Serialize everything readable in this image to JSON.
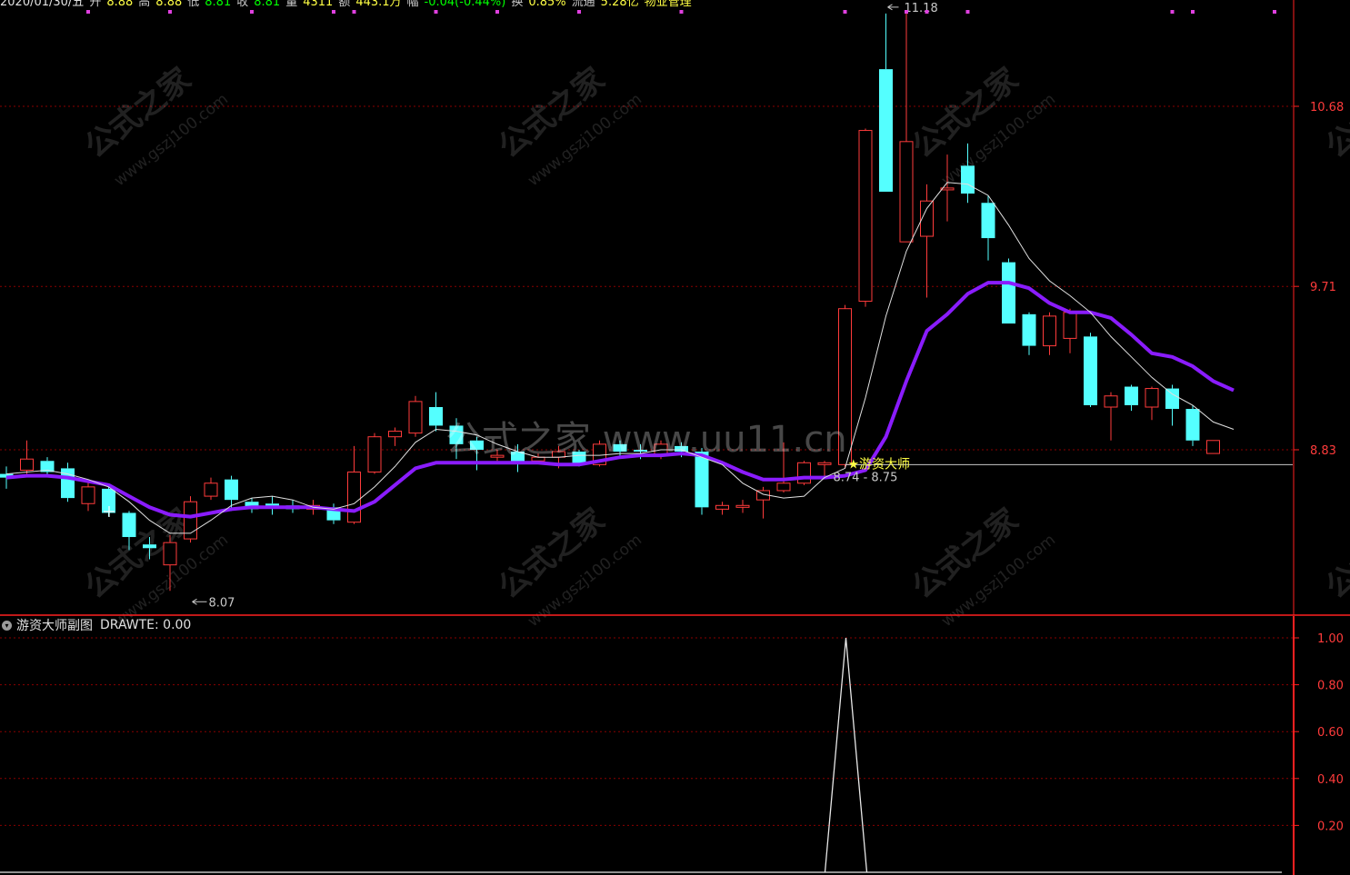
{
  "top_status": {
    "date": "2020/01/30/五",
    "open_label": "开",
    "open": "8.88",
    "high_label": "高",
    "high": "8.88",
    "low_label": "低",
    "low": "8.81",
    "close_label": "收",
    "close": "8.81",
    "volume_label": "量",
    "volume": "4311",
    "amount_label": "额",
    "amount": "443.1万",
    "change_label": "幅",
    "change": "-0.04(-0.44%)",
    "turnover_label": "换",
    "turnover": "0.85%",
    "float_label": "流通",
    "float": "5.28亿",
    "sector": "物业管理"
  },
  "watermark": {
    "brand": "公式之家",
    "site": "www.gszj100.com",
    "center": "公式之家 www.uu11.cn"
  },
  "annotations": {
    "high_label": "11.18",
    "low_label": "8.07",
    "signal_label": "★游资大师",
    "range_label": "8.74 - 8.75"
  },
  "sub_panel": {
    "title": "游资大师副图",
    "indicator": "DRAWTE: 0.00"
  },
  "colors": {
    "up": "#ff3b3b",
    "down": "#54ffff",
    "ma_long": "#8a1cff",
    "ma_short": "#e0e0e0",
    "axis": "#ff2020",
    "grid": "#8a0000",
    "signal": "#ffff44"
  },
  "chart_data": [
    {
      "type": "candlestick",
      "title": "",
      "y_ticks": [
        "10.68",
        "9.71",
        "8.83"
      ],
      "ylim": [
        7.95,
        11.5
      ],
      "grid": true,
      "candles": [
        {
          "o": 8.7,
          "c": 8.68,
          "h": 8.74,
          "l": 8.62
        },
        {
          "o": 8.72,
          "c": 8.78,
          "h": 8.88,
          "l": 8.7
        },
        {
          "o": 8.77,
          "c": 8.71,
          "h": 8.79,
          "l": 8.69
        },
        {
          "o": 8.73,
          "c": 8.57,
          "h": 8.76,
          "l": 8.55
        },
        {
          "o": 8.54,
          "c": 8.63,
          "h": 8.66,
          "l": 8.5
        },
        {
          "o": 8.62,
          "c": 8.49,
          "h": 8.64,
          "l": 8.47
        },
        {
          "o": 8.49,
          "c": 8.36,
          "h": 8.5,
          "l": 8.29
        },
        {
          "o": 8.32,
          "c": 8.3,
          "h": 8.36,
          "l": 8.24
        },
        {
          "o": 8.21,
          "c": 8.33,
          "h": 8.37,
          "l": 8.07
        },
        {
          "o": 8.35,
          "c": 8.55,
          "h": 8.58,
          "l": 8.33
        },
        {
          "o": 8.58,
          "c": 8.65,
          "h": 8.68,
          "l": 8.56
        },
        {
          "o": 8.67,
          "c": 8.56,
          "h": 8.69,
          "l": 8.5
        },
        {
          "o": 8.55,
          "c": 8.51,
          "h": 8.57,
          "l": 8.49
        },
        {
          "o": 8.54,
          "c": 8.52,
          "h": 8.58,
          "l": 8.48
        },
        {
          "o": 8.53,
          "c": 8.51,
          "h": 8.56,
          "l": 8.49
        },
        {
          "o": 8.51,
          "c": 8.53,
          "h": 8.56,
          "l": 8.48
        },
        {
          "o": 8.52,
          "c": 8.45,
          "h": 8.54,
          "l": 8.43
        },
        {
          "o": 8.44,
          "c": 8.71,
          "h": 8.85,
          "l": 8.43
        },
        {
          "o": 8.71,
          "c": 8.9,
          "h": 8.92,
          "l": 8.7
        },
        {
          "o": 8.9,
          "c": 8.93,
          "h": 8.95,
          "l": 8.85
        },
        {
          "o": 8.92,
          "c": 9.09,
          "h": 9.12,
          "l": 8.9
        },
        {
          "o": 9.06,
          "c": 8.96,
          "h": 9.14,
          "l": 8.93
        },
        {
          "o": 8.96,
          "c": 8.86,
          "h": 9.0,
          "l": 8.78
        },
        {
          "o": 8.88,
          "c": 8.83,
          "h": 8.9,
          "l": 8.72
        },
        {
          "o": 8.79,
          "c": 8.8,
          "h": 8.83,
          "l": 8.77
        },
        {
          "o": 8.82,
          "c": 8.76,
          "h": 8.86,
          "l": 8.71
        },
        {
          "o": 8.77,
          "c": 8.79,
          "h": 8.81,
          "l": 8.76
        },
        {
          "o": 8.79,
          "c": 8.82,
          "h": 8.85,
          "l": 8.73
        },
        {
          "o": 8.82,
          "c": 8.75,
          "h": 8.83,
          "l": 8.74
        },
        {
          "o": 8.75,
          "c": 8.86,
          "h": 8.88,
          "l": 8.74
        },
        {
          "o": 8.86,
          "c": 8.82,
          "h": 8.88,
          "l": 8.79
        },
        {
          "o": 8.83,
          "c": 8.82,
          "h": 8.86,
          "l": 8.78
        },
        {
          "o": 8.8,
          "c": 8.86,
          "h": 8.88,
          "l": 8.78
        },
        {
          "o": 8.85,
          "c": 8.82,
          "h": 8.87,
          "l": 8.79
        },
        {
          "o": 8.82,
          "c": 8.52,
          "h": 8.84,
          "l": 8.48
        },
        {
          "o": 8.51,
          "c": 8.53,
          "h": 8.55,
          "l": 8.48
        },
        {
          "o": 8.52,
          "c": 8.53,
          "h": 8.56,
          "l": 8.49
        },
        {
          "o": 8.56,
          "c": 8.61,
          "h": 8.63,
          "l": 8.46
        },
        {
          "o": 8.61,
          "c": 8.65,
          "h": 8.87,
          "l": 8.6
        },
        {
          "o": 8.65,
          "c": 8.76,
          "h": 8.77,
          "l": 8.64
        },
        {
          "o": 8.75,
          "c": 8.76,
          "h": 8.77,
          "l": 8.68
        },
        {
          "o": 8.75,
          "c": 9.59,
          "h": 9.61,
          "l": 8.73
        },
        {
          "o": 9.63,
          "c": 10.55,
          "h": 10.56,
          "l": 9.6
        },
        {
          "o": 10.88,
          "c": 10.22,
          "h": 11.18,
          "l": 10.22
        },
        {
          "o": 9.95,
          "c": 10.49,
          "h": 11.18,
          "l": 9.95
        },
        {
          "o": 9.98,
          "c": 10.17,
          "h": 10.26,
          "l": 9.65
        },
        {
          "o": 10.23,
          "c": 10.24,
          "h": 10.42,
          "l": 10.06
        },
        {
          "o": 10.36,
          "c": 10.21,
          "h": 10.48,
          "l": 10.16
        },
        {
          "o": 10.16,
          "c": 9.97,
          "h": 10.2,
          "l": 9.85
        },
        {
          "o": 9.84,
          "c": 9.51,
          "h": 9.86,
          "l": 9.51
        },
        {
          "o": 9.56,
          "c": 9.39,
          "h": 9.57,
          "l": 9.34
        },
        {
          "o": 9.39,
          "c": 9.55,
          "h": 9.57,
          "l": 9.34
        },
        {
          "o": 9.43,
          "c": 9.57,
          "h": 9.59,
          "l": 9.35
        },
        {
          "o": 9.44,
          "c": 9.07,
          "h": 9.46,
          "l": 9.06
        },
        {
          "o": 9.06,
          "c": 9.12,
          "h": 9.14,
          "l": 8.88
        },
        {
          "o": 9.17,
          "c": 9.07,
          "h": 9.18,
          "l": 9.04
        },
        {
          "o": 9.06,
          "c": 9.16,
          "h": 9.17,
          "l": 8.99
        },
        {
          "o": 9.16,
          "c": 9.05,
          "h": 9.18,
          "l": 8.96
        },
        {
          "o": 9.05,
          "c": 8.88,
          "h": 9.07,
          "l": 8.85
        },
        {
          "o": 8.81,
          "c": 8.88,
          "h": 8.88,
          "l": 8.81
        }
      ],
      "series": [
        {
          "style": "thick-purple",
          "values": [
            8.68,
            8.69,
            8.69,
            8.68,
            8.66,
            8.64,
            8.58,
            8.52,
            8.48,
            8.47,
            8.49,
            8.51,
            8.52,
            8.52,
            8.52,
            8.52,
            8.51,
            8.5,
            8.55,
            8.64,
            8.73,
            8.76,
            8.76,
            8.76,
            8.76,
            8.76,
            8.76,
            8.75,
            8.75,
            8.77,
            8.79,
            8.8,
            8.8,
            8.81,
            8.8,
            8.76,
            8.71,
            8.67,
            8.67,
            8.68,
            8.68,
            8.69,
            8.72,
            8.9,
            9.2,
            9.47,
            9.56,
            9.67,
            9.73,
            9.73,
            9.7,
            9.62,
            9.57,
            9.57,
            9.54,
            9.45,
            9.35,
            9.33,
            9.28,
            9.2,
            9.15
          ]
        },
        {
          "style": "thin-white",
          "values": [
            8.7,
            8.71,
            8.72,
            8.7,
            8.67,
            8.63,
            8.55,
            8.45,
            8.38,
            8.38,
            8.45,
            8.53,
            8.57,
            8.58,
            8.56,
            8.52,
            8.51,
            8.54,
            8.63,
            8.74,
            8.87,
            8.94,
            8.93,
            8.91,
            8.86,
            8.82,
            8.79,
            8.79,
            8.8,
            8.8,
            8.81,
            8.81,
            8.83,
            8.83,
            8.79,
            8.75,
            8.65,
            8.59,
            8.57,
            8.58,
            8.68,
            8.73,
            9.11,
            9.55,
            9.9,
            10.13,
            10.27,
            10.26,
            10.2,
            10.04,
            9.86,
            9.74,
            9.66,
            9.57,
            9.44,
            9.33,
            9.22,
            9.13,
            9.07,
            8.98,
            8.94
          ]
        }
      ]
    },
    {
      "type": "line",
      "title": "游资大师副图",
      "y_ticks": [
        "1.00",
        "0.80",
        "0.60",
        "0.40",
        "0.20"
      ],
      "ylim": [
        -0.1,
        1.0
      ],
      "grid": true,
      "series": [
        {
          "name": "DRAWTE",
          "values": [
            0,
            0,
            0,
            0,
            0,
            0,
            0,
            0,
            0,
            0,
            0,
            0,
            0,
            0,
            0,
            0,
            0,
            0,
            0,
            0,
            0,
            0,
            0,
            0,
            0,
            0,
            0,
            0,
            0,
            0,
            0,
            0,
            0,
            0,
            0,
            0,
            0,
            0,
            0,
            0,
            0,
            1,
            0,
            0,
            0,
            0,
            0,
            0,
            0,
            0,
            0,
            0,
            0,
            0,
            0,
            0,
            0,
            0,
            0,
            0
          ]
        }
      ]
    }
  ]
}
